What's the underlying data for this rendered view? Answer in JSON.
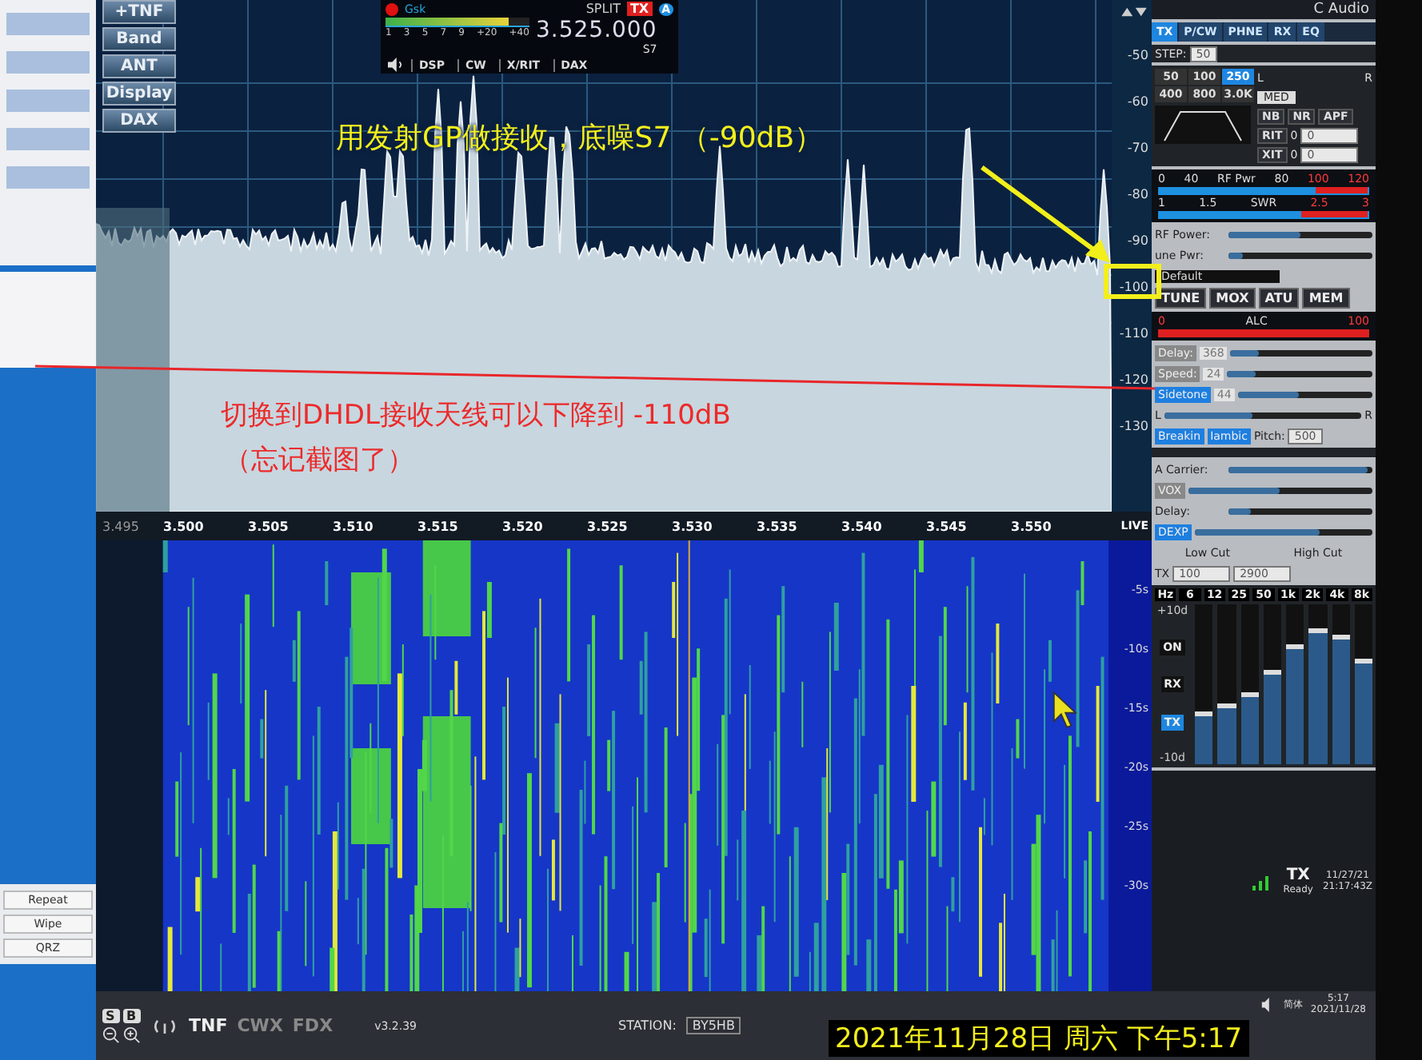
{
  "desktop": {
    "buttons": [
      "Repeat",
      "Wipe",
      "QRZ"
    ]
  },
  "left_buttons": [
    "+TNF",
    "Band",
    "ANT",
    "Display",
    "DAX"
  ],
  "slice": {
    "mode": "Gsk",
    "split": "SPLIT",
    "tx": "TX",
    "vfo": "A",
    "frequency": "3.525.000",
    "s_reading": "S7",
    "level": 0.85,
    "scale": [
      "1",
      "3",
      "5",
      "7",
      "9",
      "+20",
      "+40"
    ],
    "buttons": [
      "DSP",
      "CW",
      "X/RIT",
      "DAX"
    ]
  },
  "db_scale": [
    "-50",
    "-60",
    "-70",
    "-80",
    "-90",
    "-100",
    "-110",
    "-120",
    "-130"
  ],
  "freq_axis": [
    "3.495",
    "3.500",
    "3.505",
    "3.510",
    "3.515",
    "3.520",
    "3.525",
    "3.530",
    "3.535",
    "3.540",
    "3.545",
    "3.550"
  ],
  "live": "LIVE",
  "time_scale": [
    "-5s",
    "-10s",
    "-15s",
    "-20s",
    "-25s",
    "-30s"
  ],
  "panel": {
    "title": "C Audio",
    "tabs": [
      {
        "label": "TX",
        "selected": true
      },
      {
        "label": "P/CW",
        "selected": false
      },
      {
        "label": "PHNE",
        "selected": false
      },
      {
        "label": "RX",
        "selected": false
      },
      {
        "label": "EQ",
        "selected": false
      }
    ],
    "step_label": "STEP:",
    "step": "50",
    "filters": [
      {
        "label": "50",
        "selected": false
      },
      {
        "label": "100",
        "selected": false
      },
      {
        "label": "250",
        "selected": true
      },
      {
        "label": "400",
        "selected": false
      },
      {
        "label": "800",
        "selected": false
      },
      {
        "label": "3.0K",
        "selected": false
      }
    ],
    "pan_left": "L",
    "pan_right": "R",
    "agc": "MED",
    "dsp": [
      "NB",
      "NR",
      "APF"
    ],
    "rit": {
      "label": "RIT",
      "on": "0",
      "value": "0"
    },
    "xit": {
      "label": "XIT",
      "on": "0",
      "value": "0"
    },
    "rf_meter": [
      "0",
      "40",
      "RF Pwr",
      "80",
      "100",
      "120"
    ],
    "swr_meter": [
      "1",
      "1.5",
      "SWR",
      "2.5",
      "3"
    ],
    "sliders": [
      {
        "label": "RF Power:",
        "level": 0.5
      },
      {
        "label": "une Pwr:",
        "level": 0.1
      }
    ],
    "profile": "Default",
    "buttons": [
      "TUNE",
      "MOX",
      "ATU",
      "MEM"
    ],
    "alc": [
      "0",
      "ALC",
      "100"
    ],
    "cw": [
      {
        "label": "Delay:",
        "value": "368",
        "level": 0.2,
        "on": false
      },
      {
        "label": "Speed:",
        "value": "24",
        "level": 0.2,
        "on": false
      },
      {
        "label": "Sidetone",
        "value": "44",
        "level": 0.45,
        "on": true
      }
    ],
    "cw_pan": {
      "left": "L",
      "right": "R",
      "level": 0.45
    },
    "cw_buttons": [
      {
        "label": "Breakin",
        "on": true
      },
      {
        "label": "Iambic",
        "on": true
      }
    ],
    "pitch_label": "Pitch:",
    "pitch": "500",
    "tx_sliders": [
      {
        "label": "A Carrier:",
        "level": 0.97,
        "kind": "text"
      },
      {
        "label": "VOX",
        "level": 0.5,
        "kind": "button",
        "on": false
      },
      {
        "label": "Delay:",
        "level": 0.15,
        "kind": "text"
      },
      {
        "label": "DEXP",
        "level": 0.7,
        "kind": "button",
        "on": true
      }
    ],
    "low_cut_label": "Low Cut",
    "high_cut_label": "High Cut",
    "tx_label": "TX",
    "low_cut": "100",
    "high_cut": "2900",
    "eq": {
      "hz": "Hz",
      "top": "+10d",
      "bottom": "-10d",
      "buttons": [
        {
          "label": "ON",
          "selected": false
        },
        {
          "label": "RX",
          "selected": false
        },
        {
          "label": "TX",
          "selected": true
        }
      ],
      "bands": [
        {
          "label": "6",
          "level": 0.3
        },
        {
          "label": "12",
          "level": 0.35
        },
        {
          "label": "25",
          "level": 0.42
        },
        {
          "label": "50",
          "level": 0.56
        },
        {
          "label": "1k",
          "level": 0.72
        },
        {
          "label": "2k",
          "level": 0.82
        },
        {
          "label": "4k",
          "level": 0.78
        },
        {
          "label": "8k",
          "level": 0.63
        }
      ]
    },
    "status": {
      "tx": "TX",
      "ready": "Ready",
      "date": "11/27/21",
      "time": "21:17:43Z"
    }
  },
  "footer": {
    "keys": [
      "S",
      "B"
    ],
    "modes": [
      "TNF",
      "CWX",
      "FDX"
    ],
    "version": "v3.2.39",
    "station_label": "STATION:",
    "station": "BY5HB"
  },
  "taskbar": {
    "lang": "简体",
    "time": "5:17",
    "date": "2021/11/28"
  },
  "annotations": {
    "note_top": "用发射GP做接收，底噪S7 （-90dB）",
    "note_red": "切换到DHDL接收天线可以下降到 -110dB",
    "note_red_2": "（忘记截图了）",
    "timestamp": "2021年11月28日  周六 下午5:17"
  }
}
